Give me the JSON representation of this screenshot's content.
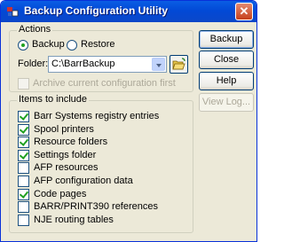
{
  "window": {
    "title": "Backup Configuration Utility",
    "close_label": "✕"
  },
  "actions": {
    "legend": "Actions",
    "backup_label": "Backup",
    "restore_label": "Restore",
    "selected": "backup",
    "folder_label": "Folder:",
    "folder_value": "C:\\BarrBackup",
    "archive_label": "Archive current configuration first"
  },
  "buttons": {
    "backup": "Backup",
    "close": "Close",
    "help": "Help",
    "view_log": "View Log..."
  },
  "items": {
    "legend": "Items to include",
    "list": [
      {
        "label": "Barr Systems registry entries",
        "checked": true
      },
      {
        "label": "Spool printers",
        "checked": true
      },
      {
        "label": "Resource folders",
        "checked": true
      },
      {
        "label": "Settings folder",
        "checked": true
      },
      {
        "label": "AFP resources",
        "checked": false
      },
      {
        "label": "AFP configuration data",
        "checked": false
      },
      {
        "label": "Code pages",
        "checked": true
      },
      {
        "label": "BARR/PRINT390 references",
        "checked": false
      },
      {
        "label": "NJE routing tables",
        "checked": false
      }
    ]
  },
  "colors": {
    "titlebar": "#0a5ee4",
    "check": "#21a121",
    "face": "#ece9d8"
  }
}
